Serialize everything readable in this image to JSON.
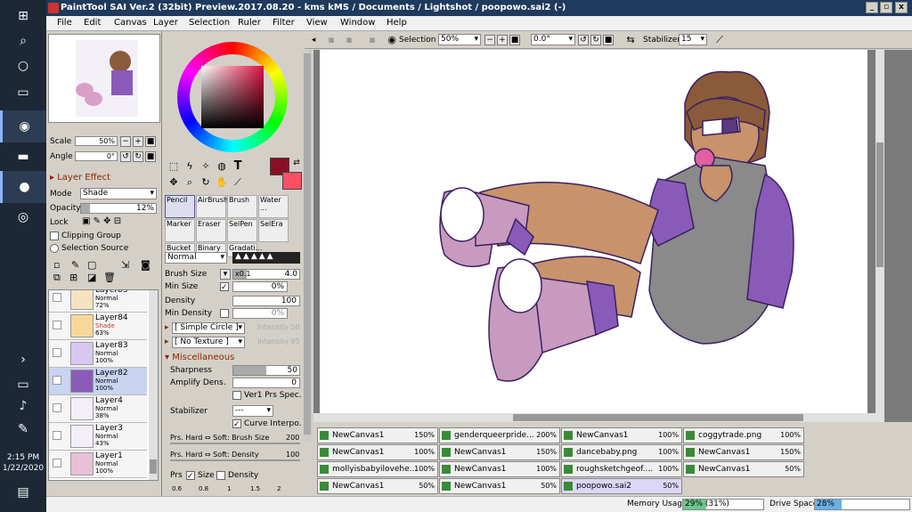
{
  "title": "PaintTool SAI Ver.2 (32bit) Preview.2017.08.20 - kms kMS / Documents / Lightshot / poopowo.sai2 (-)",
  "window_controls": {
    "minimize": "_",
    "maximize": "▫",
    "close": "x"
  },
  "menu": [
    "File",
    "Edit",
    "Canvas",
    "Layer",
    "Selection",
    "Ruler",
    "Filter",
    "View",
    "Window",
    "Help"
  ],
  "taskbar": {
    "time": "2:15 PM",
    "date": "1/22/2020"
  },
  "navigator": {
    "scale_label": "Scale",
    "scale": "50%",
    "angle_label": "Angle",
    "angle": "0°"
  },
  "layer_effect": "Layer Effect",
  "layer_props": {
    "mode_label": "Mode",
    "mode": "Shade",
    "opacity_label": "Opacity",
    "opacity": "12%",
    "opacity_frac": 0.12,
    "lock_label": "Lock",
    "clipping": "Clipping Group",
    "selsource": "Selection Source"
  },
  "layers": [
    {
      "name": "Layer85",
      "mode": "Normal",
      "opacity": "72%",
      "thumb": "#f4e3c0"
    },
    {
      "name": "Layer84",
      "mode": "Shade",
      "opacity": "63%",
      "thumb": "#f8d89a",
      "mode_color": "#c0392b"
    },
    {
      "name": "Layer83",
      "mode": "Normal",
      "opacity": "100%",
      "thumb": "#d8c8f0"
    },
    {
      "name": "Layer82",
      "mode": "Normal",
      "opacity": "100%",
      "thumb": "#8a5ab8",
      "selected": true
    },
    {
      "name": "Layer4",
      "mode": "Normal",
      "opacity": "38%",
      "thumb": "#f4eef8"
    },
    {
      "name": "Layer3",
      "mode": "Normal",
      "opacity": "43%",
      "thumb": "#f4eef8"
    },
    {
      "name": "Layer1",
      "mode": "Normal",
      "opacity": "100%",
      "thumb": "#e8c0d8"
    }
  ],
  "colors": {
    "primary": "#8a0f24",
    "secondary": "#ff4f64"
  },
  "brushes": [
    {
      "label": "Pencil",
      "selected": true
    },
    {
      "label": "AirBrush"
    },
    {
      "label": "Brush"
    },
    {
      "label": "Water ..."
    },
    {
      "label": "Marker"
    },
    {
      "label": "Eraser"
    },
    {
      "label": "SelPen"
    },
    {
      "label": "SelEra"
    },
    {
      "label": "Bucket"
    },
    {
      "label": "Binary"
    },
    {
      "label": "Gradati..."
    }
  ],
  "brush_settings": {
    "blend": "Normal",
    "size_label": "Brush Size",
    "size_mult": "x0.1",
    "size": "4.0",
    "minsize_label": "Min Size",
    "minsize": "0%",
    "density_label": "Density",
    "density": "100",
    "mindensity_label": "Min Density",
    "mindensity": "0%",
    "shape": "[ Simple Circle ]",
    "shape_intensity": "Intensity 50",
    "texture": "[ No Texture ]",
    "texture_intensity": "Intensity 95",
    "misc": "Miscellaneous",
    "sharpness_label": "Sharpness",
    "sharpness": "50",
    "amplify_label": "Amplify Dens.",
    "amplify": "0",
    "ver1": "Ver1 Prs Spec.",
    "stabilizer_label": "Stabilizer",
    "stabilizer": "---",
    "curve": "Curve Interpo.",
    "prs_size_label": "Prs. Hard ⇔ Soft: Brush Size",
    "prs_size": "200",
    "prs_density_label": "Prs. Hard ⇔ Soft: Density",
    "prs_density": "100",
    "prs_label": "Prs",
    "prs_sizechk": "Size",
    "prs_densitychk": "Density",
    "sizes": [
      "0.6",
      "0.8",
      "1",
      "1.5",
      "2"
    ]
  },
  "toolbar": {
    "selection": "Selection",
    "zoom": "50%",
    "rotate": "0.0°",
    "stabilizer_label": "Stabilizer",
    "stabilizer": "15"
  },
  "documents": [
    {
      "name": "NewCanvas1",
      "pct": "150%"
    },
    {
      "name": "genderqueerpride...",
      "pct": "200%"
    },
    {
      "name": "NewCanvas1",
      "pct": "100%"
    },
    {
      "name": "coggytrade.png",
      "pct": "100%"
    },
    {
      "name": "NewCanvas1",
      "pct": "100%"
    },
    {
      "name": "NewCanvas1",
      "pct": "150%"
    },
    {
      "name": "dancebaby.png",
      "pct": "100%"
    },
    {
      "name": "NewCanvas1",
      "pct": "150%"
    },
    {
      "name": "mollyisbabyilovehe...",
      "pct": "100%"
    },
    {
      "name": "NewCanvas1",
      "pct": "100%"
    },
    {
      "name": "roughsketchgeof....",
      "pct": "100%"
    },
    {
      "name": "NewCanvas1",
      "pct": "50%"
    },
    {
      "name": "NewCanvas1",
      "pct": "50%"
    },
    {
      "name": "NewCanvas1",
      "pct": "50%"
    },
    {
      "name": "poopowo.sai2",
      "pct": "50%",
      "selected": true
    }
  ],
  "status": {
    "memory_label": "Memory Usage",
    "memory": "29% (31%)",
    "memory_frac": 0.29,
    "drive_label": "Drive Space",
    "drive": "28%",
    "drive_frac": 0.28
  }
}
